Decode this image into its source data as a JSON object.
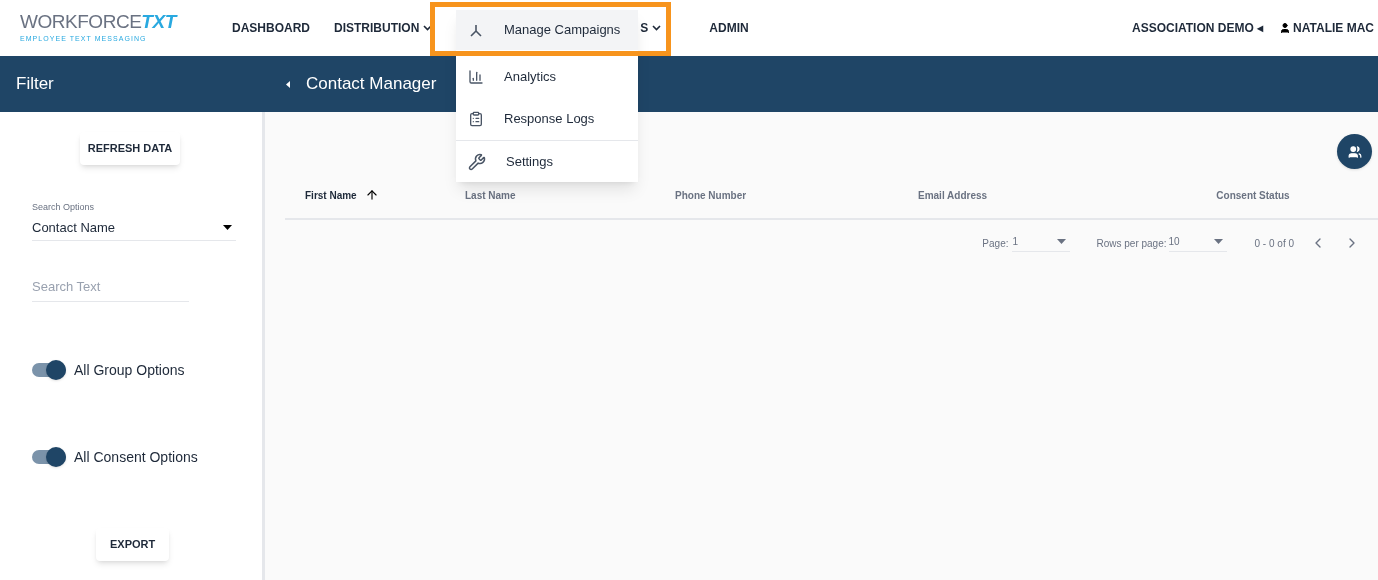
{
  "logo": {
    "name": "WORKFORCE",
    "accent": "TXT",
    "tagline": "EMPLOYEE TEXT MESSAGING"
  },
  "nav": [
    {
      "label": "DASHBOARD",
      "dropdown": false
    },
    {
      "label": "DISTRIBUTION",
      "dropdown": true
    },
    {
      "label": "S",
      "dropdown": true
    },
    {
      "label": "ADMIN",
      "dropdown": false
    }
  ],
  "account": {
    "organization": "ASSOCIATION DEMO",
    "org_caret": "◂",
    "user": "NATALIE MAC"
  },
  "menu": [
    {
      "label": "Manage Campaigns",
      "kind": "campaigns",
      "selected": true
    },
    {
      "label": "Analytics",
      "kind": "analytics",
      "selected": false
    },
    {
      "label": "Response Logs",
      "kind": "logs",
      "selected": false
    },
    {
      "label": "Settings",
      "kind": "settings",
      "selected": false
    }
  ],
  "filter": {
    "title": "Filter",
    "refresh_button": "REFRESH DATA",
    "search_options_label": "Search Options",
    "search_option": "Contact Name",
    "search_placeholder": "Search Text",
    "toggles": [
      {
        "label": "All Group Options",
        "on": true
      },
      {
        "label": "All Consent Options",
        "on": true
      }
    ],
    "export_button": "EXPORT"
  },
  "main": {
    "title": "Contact Manager",
    "columns": [
      {
        "label": "First Name",
        "sorted": true
      },
      {
        "label": "Last Name",
        "sorted": false
      },
      {
        "label": "Phone Number",
        "sorted": false
      },
      {
        "label": "Email Address",
        "sorted": false
      },
      {
        "label": "Consent Status",
        "sorted": false
      }
    ],
    "pagination": {
      "page_label": "Page:",
      "page": "1",
      "rows_label": "Rows per page:",
      "rows": "10",
      "range": "0 - 0 of 0"
    }
  }
}
